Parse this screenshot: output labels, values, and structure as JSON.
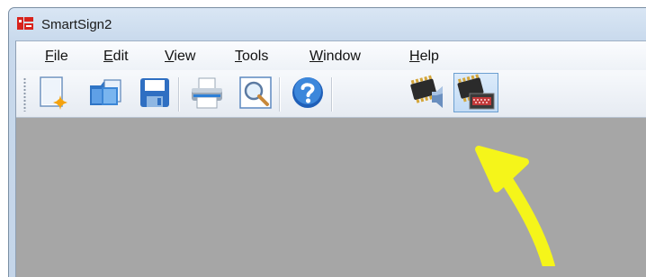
{
  "window": {
    "title": "SmartSign2"
  },
  "menu": {
    "items": [
      {
        "ul": "F",
        "rest": "ile"
      },
      {
        "ul": "E",
        "rest": "dit"
      },
      {
        "ul": "V",
        "rest": "iew"
      },
      {
        "ul": "T",
        "rest": "ools"
      },
      {
        "ul": "W",
        "rest": "indow"
      },
      {
        "ul": "H",
        "rest": "elp"
      }
    ]
  },
  "toolbar": {
    "buttons": [
      {
        "icon": "new-document-icon"
      },
      {
        "icon": "open-folder-icon"
      },
      {
        "icon": "save-disk-icon"
      },
      {
        "icon": "printer-icon"
      },
      {
        "icon": "print-preview-magnifier-icon"
      },
      {
        "icon": "help-question-icon"
      },
      {
        "icon": "chip-speaker-icon"
      },
      {
        "icon": "chip-display-icon",
        "active": true
      }
    ]
  },
  "annotation": {
    "arrow_color": "#f5f51a"
  }
}
